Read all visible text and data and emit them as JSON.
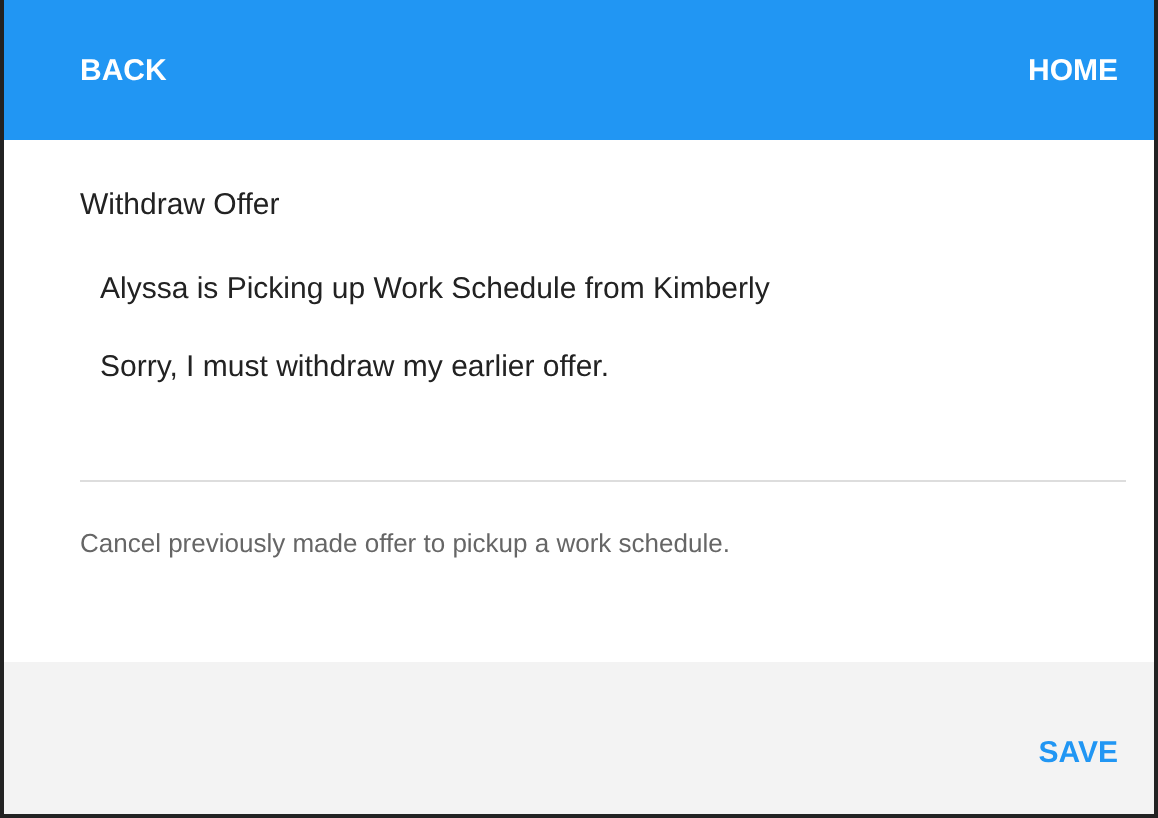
{
  "header": {
    "back": "BACK",
    "home": "HOME"
  },
  "title": "Withdraw Offer",
  "summary": "Alyssa is Picking up Work Schedule from Kimberly",
  "message": {
    "value": "Sorry, I must withdraw my earlier offer."
  },
  "helper": "Cancel previously made offer to pickup a work schedule.",
  "footer": {
    "save": "SAVE"
  }
}
